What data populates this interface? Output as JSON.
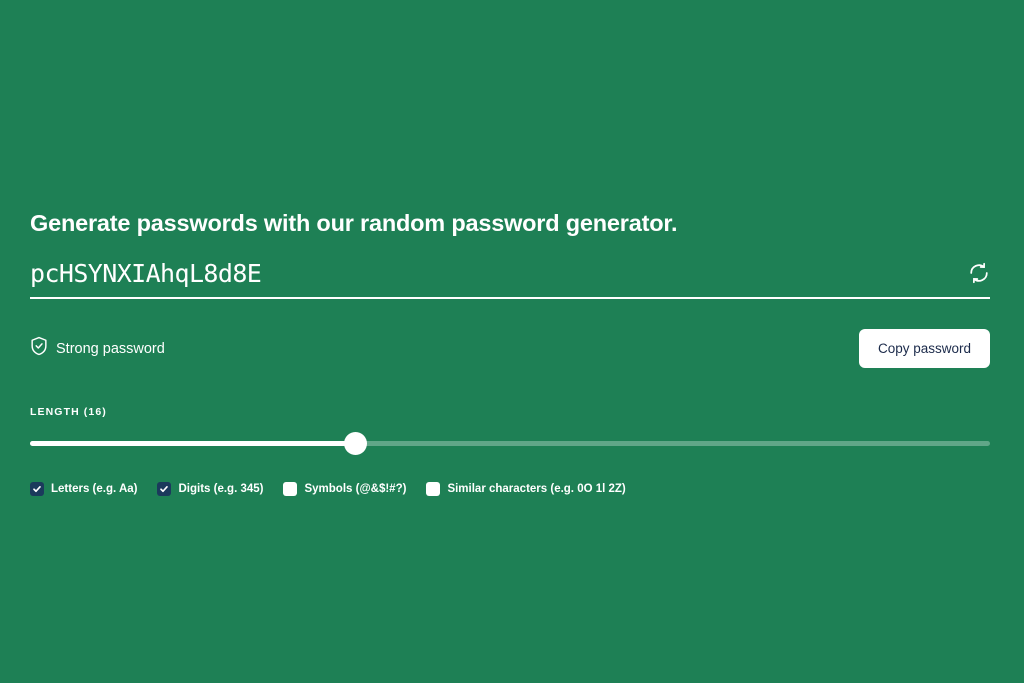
{
  "theme": {
    "background": "#1e8055",
    "text": "#ffffff",
    "button_bg": "#ffffff",
    "button_text": "#1b2a4a",
    "checkbox_checked": "#1b3a5c"
  },
  "headline": "Generate passwords with our random password generator.",
  "password": {
    "value": "pcHSYNXIAhqL8d8E",
    "refresh_icon": "refresh-icon"
  },
  "strength": {
    "icon": "shield-check-icon",
    "label": "Strong password"
  },
  "copy": {
    "label": "Copy password"
  },
  "length": {
    "label": "LENGTH (16)",
    "value": 16,
    "min": 1,
    "max": 44,
    "percent": 33.9
  },
  "options": [
    {
      "label": "Letters (e.g. Aa)",
      "checked": true,
      "name": "letters"
    },
    {
      "label": "Digits (e.g. 345)",
      "checked": true,
      "name": "digits"
    },
    {
      "label": "Symbols (@&$!#?)",
      "checked": false,
      "name": "symbols"
    },
    {
      "label": "Similar characters (e.g. 0O 1l 2Z)",
      "checked": false,
      "name": "similar-characters"
    }
  ]
}
